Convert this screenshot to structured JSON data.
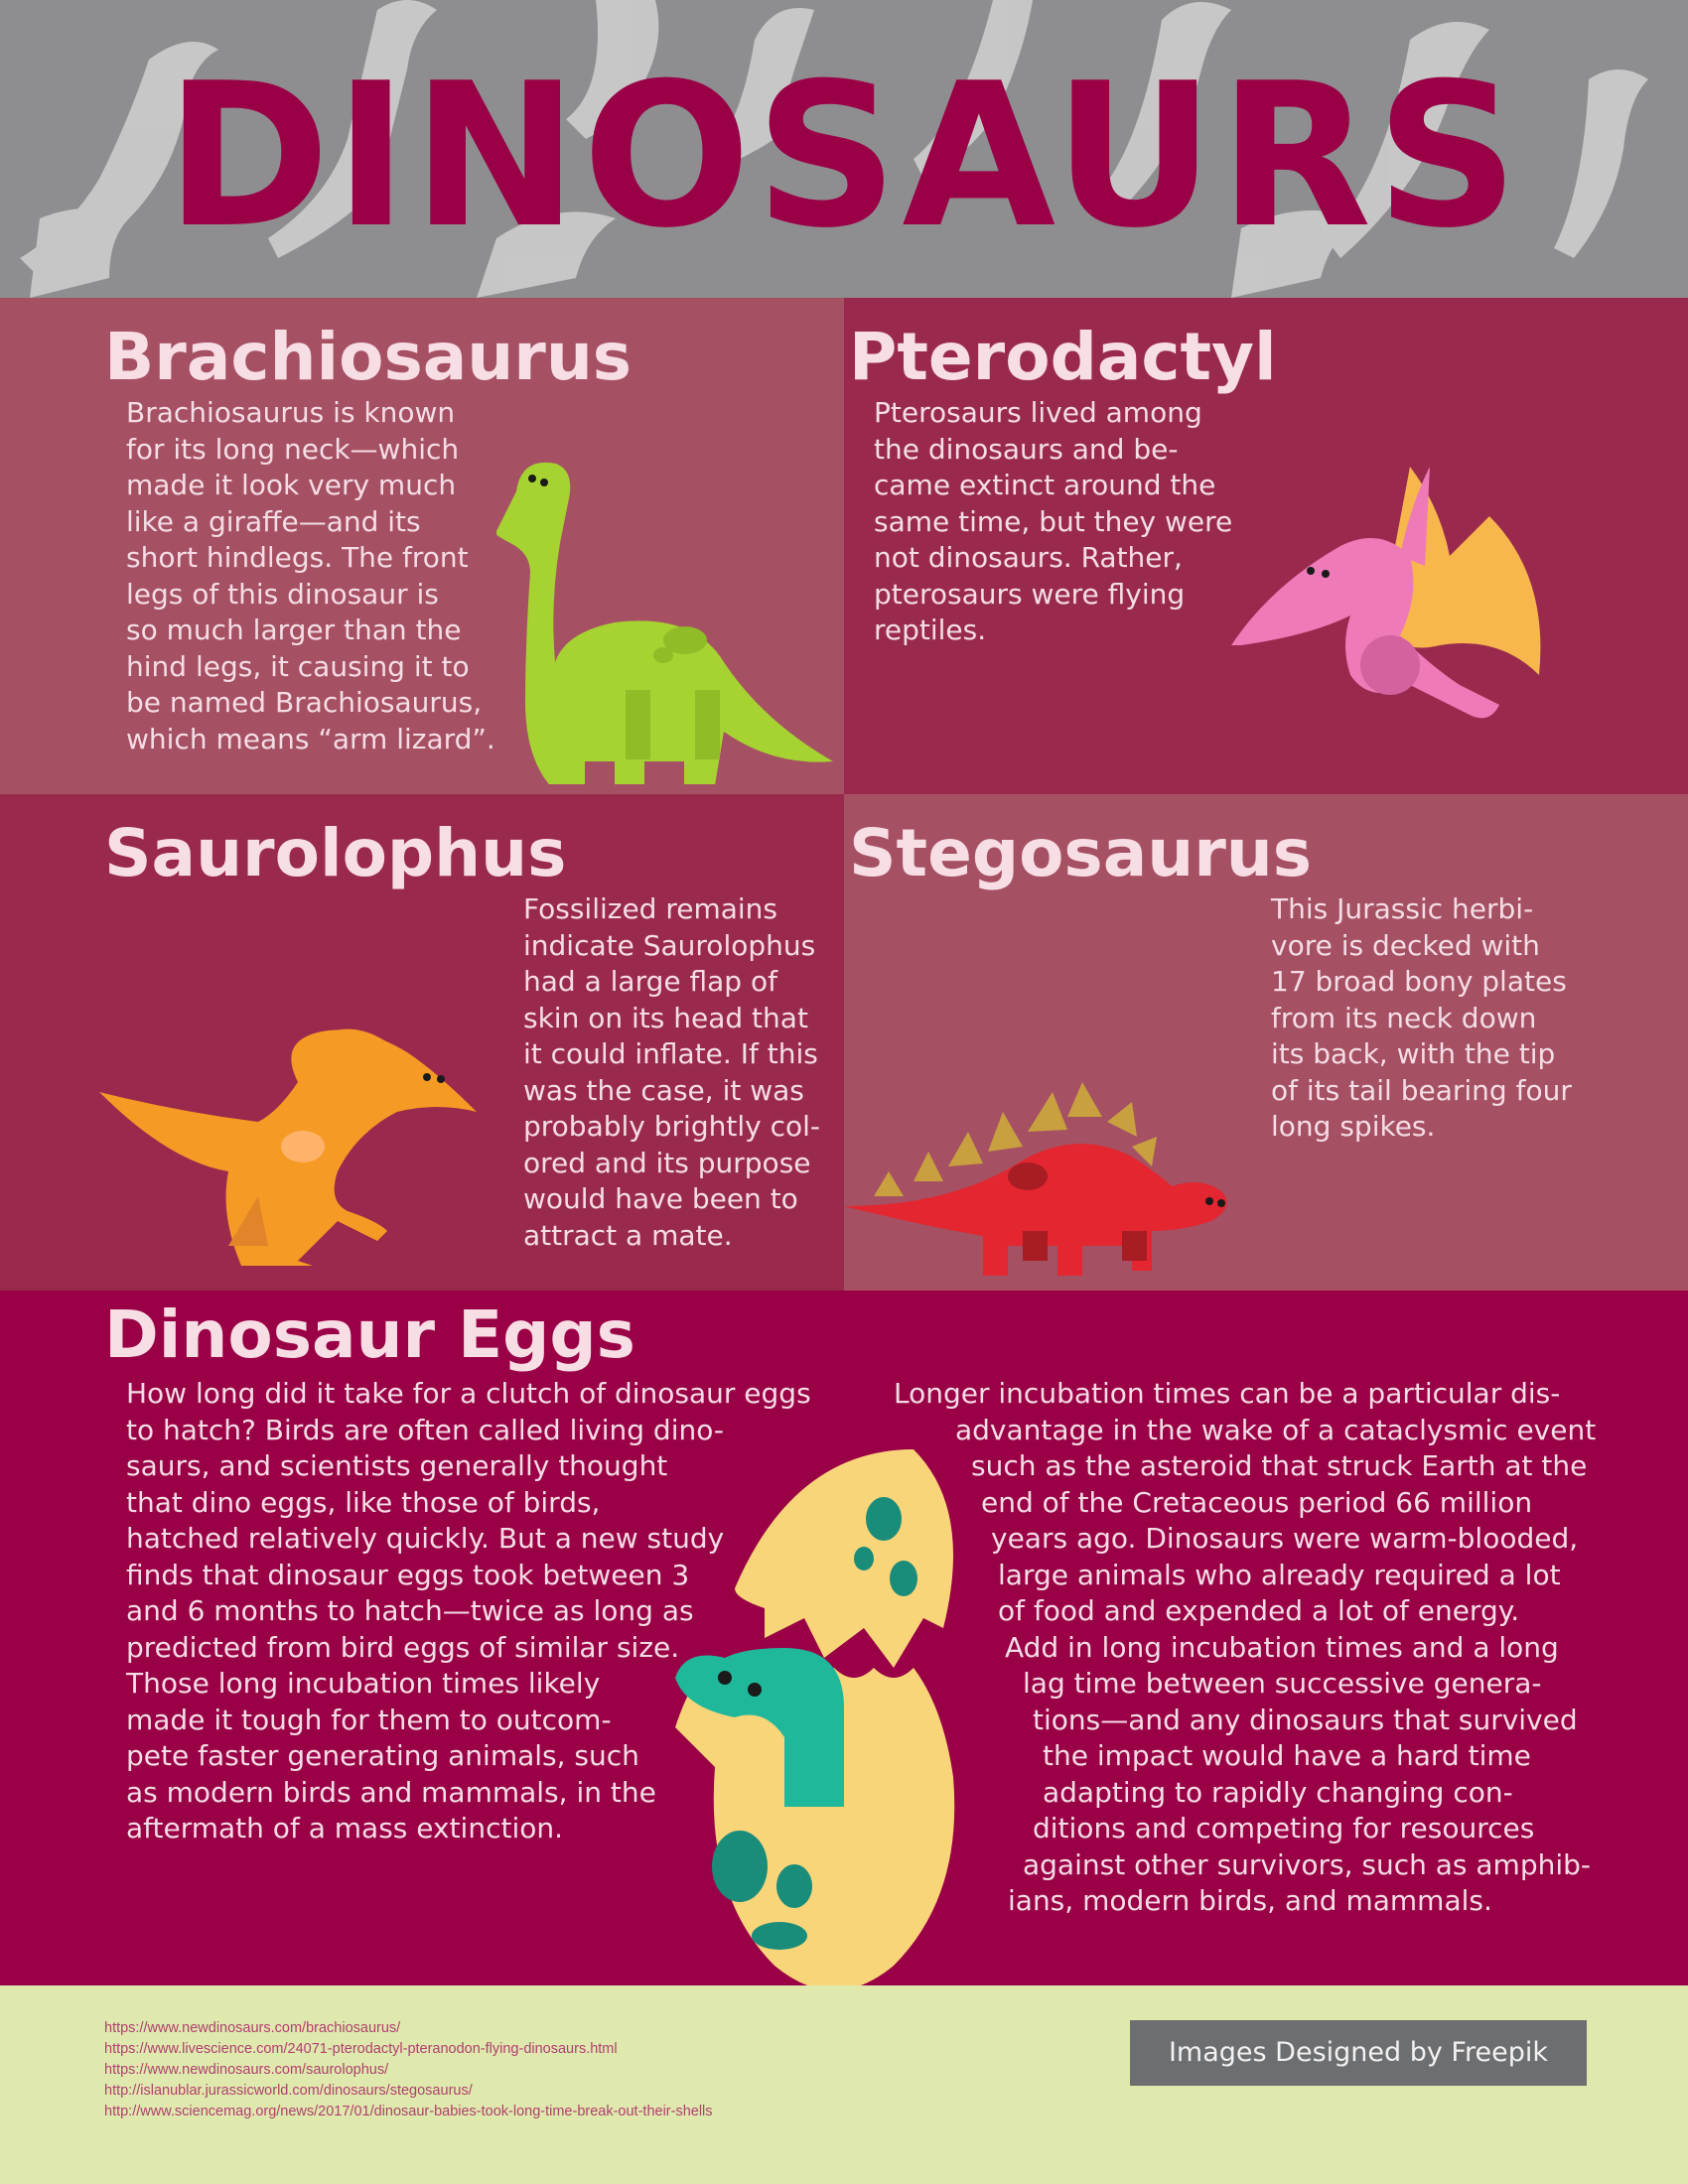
{
  "title": "DINOSAURS",
  "colors": {
    "header_bg": "#8e8e91",
    "silhouette": "#cdcdcd",
    "title": "#9a0046",
    "panel_light": "#a65063",
    "panel_dark": "#9a2a4d",
    "eggs_bg": "#9a0046",
    "footer_bg": "#dfe8ad",
    "heading_text": "#f7dde4",
    "credit_bg": "#6d6e70"
  },
  "sections": {
    "brachiosaurus": {
      "heading": "Brachiosaurus",
      "lines": [
        "Brachiosaurus is known",
        "for its long neck—which",
        "made it look very much",
        "like a giraffe—and its",
        "short hindlegs. The front",
        "legs of this dinosaur is",
        "so much larger than the",
        "hind legs, it causing it to",
        "be named Brachiosaurus,",
        "which means “arm lizard”."
      ],
      "illustration": "green-brachiosaurus-icon"
    },
    "pterodactyl": {
      "heading": "Pterodactyl",
      "lines": [
        "Pterosaurs lived among",
        "the dinosaurs and be-",
        "came extinct around the",
        "same time, but they were",
        "not dinosaurs. Rather,",
        "pterosaurs were flying",
        "reptiles."
      ],
      "illustration": "pink-pterodactyl-icon"
    },
    "saurolophus": {
      "heading": "Saurolophus",
      "lines": [
        "Fossilized remains",
        "indicate Saurolophus",
        "had a large flap of",
        "skin on its head that",
        "it could inflate. If this",
        "was the case, it was",
        "probably brightly col-",
        "ored and its purpose",
        "would have been to",
        "attract a mate."
      ],
      "illustration": "orange-saurolophus-icon"
    },
    "stegosaurus": {
      "heading": "Stegosaurus",
      "lines": [
        "This Jurassic herbi-",
        "vore is decked with",
        "17 broad bony plates",
        "from its neck down",
        "its back, with the tip",
        "of its tail bearing four",
        "long spikes."
      ],
      "illustration": "red-stegosaurus-icon"
    },
    "eggs": {
      "heading": "Dinosaur Eggs",
      "left_lines": [
        "How long did it take for a clutch of dinosaur eggs",
        "to hatch? Birds are often called living dino-",
        "saurs, and scientists generally thought",
        "that dino eggs, like those of birds,",
        "hatched relatively quickly. But a new study",
        "finds that dinosaur eggs took between 3",
        "and 6 months to hatch—twice as long as",
        "predicted from bird eggs of similar size.",
        "Those long incubation times likely",
        "made it tough for them to outcom-",
        "pete faster generating animals, such",
        "as modern birds and mammals, in the",
        "aftermath of a mass extinction."
      ],
      "right_lines": [
        "Longer incubation times can be a particular dis-",
        "advantage in the wake of a cataclysmic event",
        "such as the asteroid that struck Earth at the",
        "end of the Cretaceous period 66 million",
        "years ago. Dinosaurs were warm-blooded,",
        "large animals who already required a lot",
        "of food and expended a lot of energy.",
        "Add in long incubation times and a long",
        "lag time between successive genera-",
        "tions—and any dinosaurs that survived",
        "the impact would have a hard time",
        "adapting to rapidly changing con-",
        "ditions and competing for resources",
        "against other survivors, such as amphib-",
        "ians, modern birds, and mammals."
      ],
      "illustration": "hatching-egg-icon"
    }
  },
  "footer": {
    "sources": [
      "https://www.newdinosaurs.com/brachiosaurus/",
      "https://www.livescience.com/24071-pterodactyl-pteranodon-flying-dinosaurs.html",
      "https://www.newdinosaurs.com/saurolophus/",
      "http://islanublar.jurassicworld.com/dinosaurs/stegosaurus/",
      "http://www.sciencemag.org/news/2017/01/dinosaur-babies-took-long-time-break-out-their-shells"
    ],
    "credit": "Images Designed by Freepik"
  }
}
